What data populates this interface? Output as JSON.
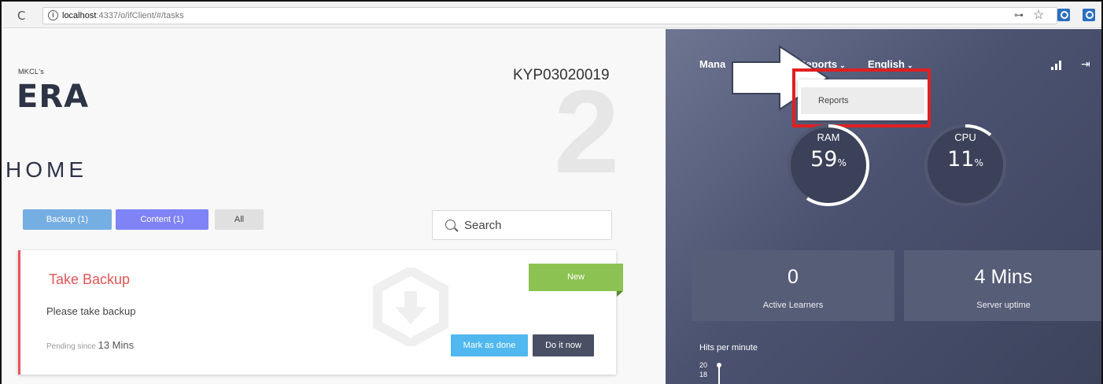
{
  "browser": {
    "reload_icon": "reload-icon",
    "url_host": "localhost",
    "url_rest": ":4337/o/ifClient/#/tasks"
  },
  "brand": {
    "small": "MKCL's",
    "big": "ERA"
  },
  "header": {
    "id": "KYP03020019",
    "big_number": "2"
  },
  "page_title": "HOME",
  "filters": {
    "backup": "Backup (1)",
    "content": "Content (1)",
    "all": "All"
  },
  "search": {
    "placeholder": "Search"
  },
  "task": {
    "title": "Take Backup",
    "description": "Please take backup",
    "pending_label": "Pending since",
    "pending_value": "13 Mins",
    "badge": "New",
    "mark_done": "Mark as done",
    "do_now": "Do it now"
  },
  "nav": {
    "manage": "Mana",
    "reports": "Reports",
    "english": "English",
    "chevron": "⌄"
  },
  "dropdown": {
    "item": "Reports"
  },
  "gauges": {
    "ram": {
      "label": "RAM",
      "value": "59",
      "unit": "%",
      "fraction": 0.59
    },
    "cpu": {
      "label": "CPU",
      "value": "11",
      "unit": "%",
      "fraction": 0.11
    }
  },
  "stats": {
    "learners_value": "0",
    "learners_label": "Active Learners",
    "uptime_value": "4 Mins",
    "uptime_label": "Server uptime"
  },
  "hits": {
    "title": "Hits per minute",
    "tick_top": "20",
    "tick_next": "18"
  },
  "colors": {
    "accent_red": "#e05555",
    "badge_green": "#8cc251",
    "button_blue": "#50b8ef",
    "button_dark": "#495064",
    "highlight": "#e02020"
  }
}
